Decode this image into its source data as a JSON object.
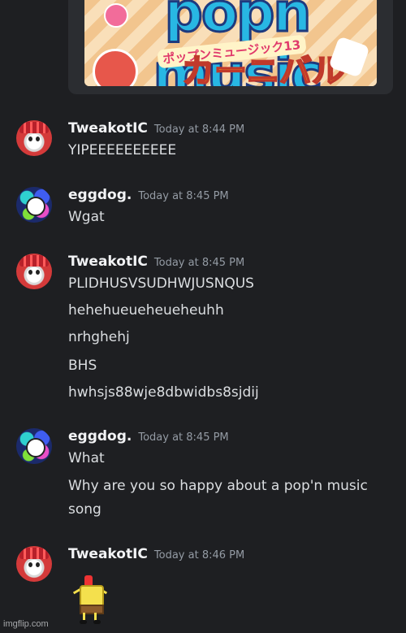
{
  "embed": {
    "logo_main": "popn music",
    "logo_sub": "ポップンミュージック13",
    "logo_carnival": "カーニバル"
  },
  "messages": [
    {
      "username": "TweakotIC",
      "timestamp": "Today at 8:44 PM",
      "lines": [
        "YIPEEEEEEEEEE"
      ]
    },
    {
      "username": "eggdog.",
      "timestamp": "Today at 8:45 PM",
      "lines": [
        "Wgat"
      ]
    },
    {
      "username": "TweakotIC",
      "timestamp": "Today at 8:45 PM",
      "lines": [
        "PLIDHUSVSUDHWJUSNQUS",
        "hehehueueheueheuhh",
        "nrhghehj",
        "BHS",
        "hwhsjs88wje8dbwidbs8sjdij"
      ]
    },
    {
      "username": "eggdog.",
      "timestamp": "Today at 8:45 PM",
      "lines": [
        "What",
        "Why are you so happy about a pop'n music",
        "song"
      ]
    },
    {
      "username": "TweakotIC",
      "timestamp": "Today at 8:46 PM",
      "lines": []
    }
  ],
  "watermark": "imgflip.com"
}
